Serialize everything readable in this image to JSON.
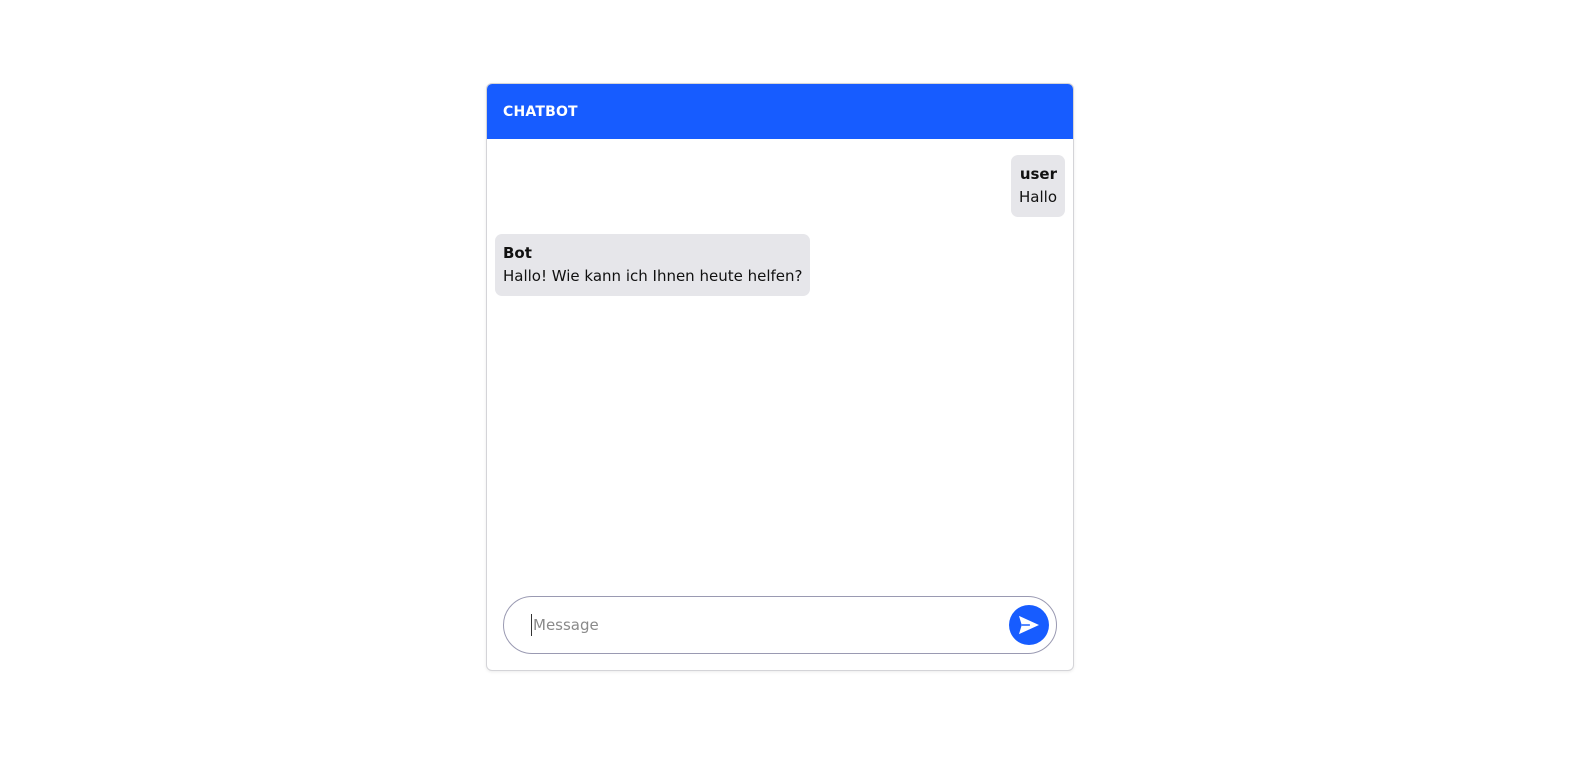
{
  "header": {
    "title": "CHATBOT"
  },
  "messages": [
    {
      "role": "user",
      "sender": "user",
      "text": "Hallo"
    },
    {
      "role": "bot",
      "sender": "Bot",
      "text": "Hallo! Wie kann ich Ihnen heute helfen?"
    }
  ],
  "composer": {
    "placeholder": "Message",
    "value": "",
    "send_icon": "send-icon"
  },
  "colors": {
    "accent": "#175cff",
    "bubble": "#e6e6ea"
  }
}
